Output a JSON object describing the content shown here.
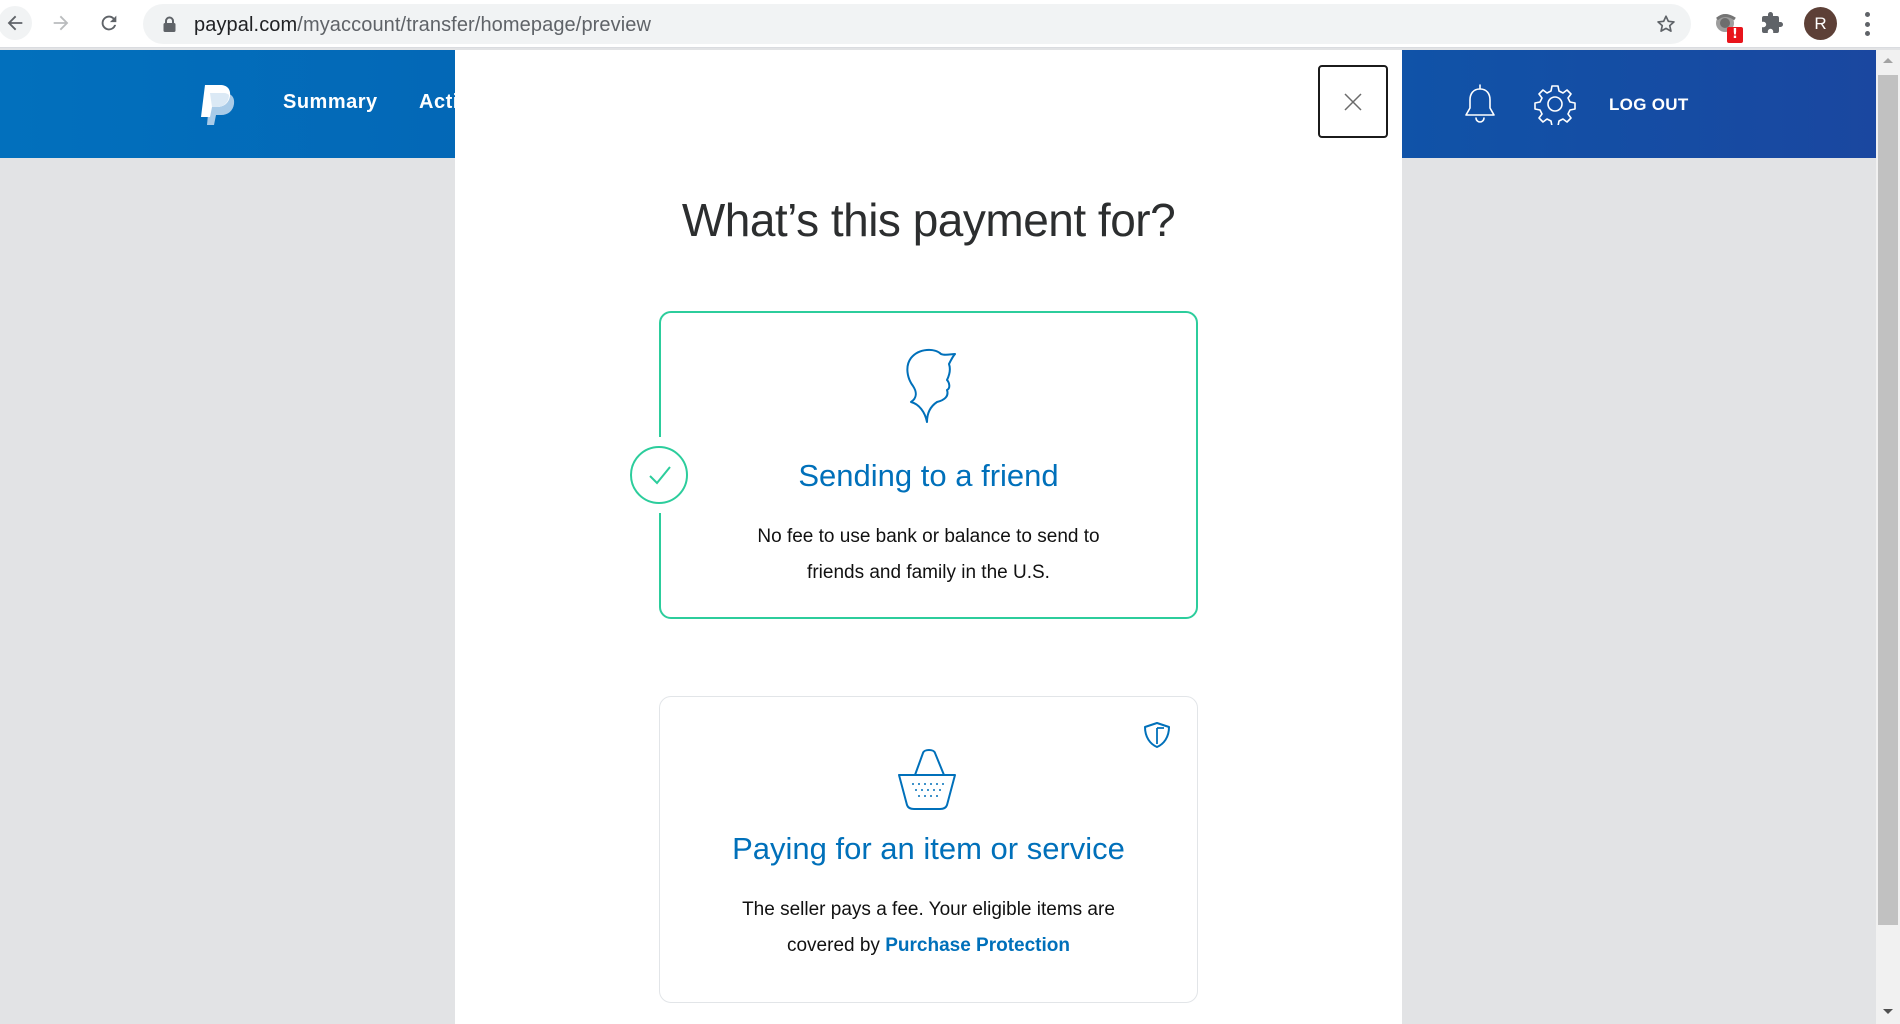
{
  "browser": {
    "url_domain": "paypal.com",
    "url_path": "/myaccount/transfer/homepage/preview",
    "profile_initial": "R",
    "extension_badge": "!"
  },
  "header": {
    "nav": [
      {
        "label": "Summary"
      },
      {
        "label": "Acti"
      }
    ],
    "logout_label": "LOG OUT"
  },
  "modal": {
    "title": "What’s this payment for?",
    "options": [
      {
        "title": "Sending to a friend",
        "description_line1": "No fee to use bank or balance to send to",
        "description_line2": "friends and family in the U.S.",
        "selected": true,
        "icon": "friend-silhouette-icon"
      },
      {
        "title": "Paying for an item or service",
        "description_line1": "The seller pays a fee. Your eligible items are",
        "description_prefix2": "covered by ",
        "link_label": "Purchase Protection",
        "selected": false,
        "icon": "shopping-basket-icon",
        "badge_icon": "shield-icon"
      }
    ]
  },
  "colors": {
    "brand_blue": "#0070ba",
    "header_blue_start": "#0270bd",
    "header_blue_end": "#1a47a0",
    "selected_green": "#2ccd9c",
    "backdrop": "#e2e3e5"
  }
}
